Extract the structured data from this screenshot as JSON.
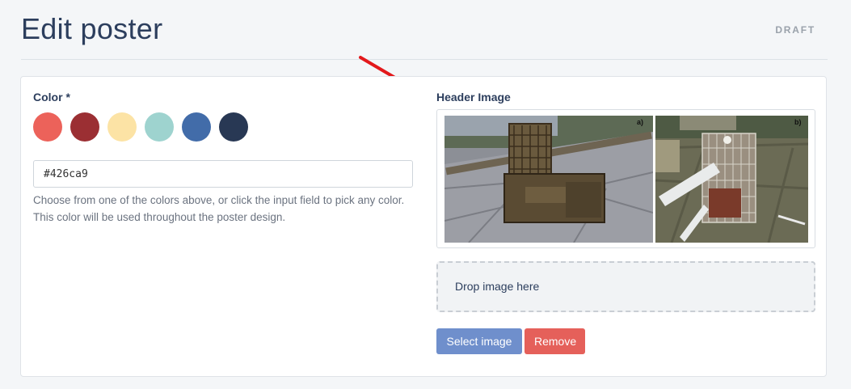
{
  "header": {
    "title": "Edit poster",
    "status": "DRAFT"
  },
  "color_section": {
    "label": "Color *",
    "swatches": [
      {
        "name": "coral",
        "color": "#ec625a"
      },
      {
        "name": "maroon",
        "color": "#9b2f33"
      },
      {
        "name": "cream",
        "color": "#fce3a5"
      },
      {
        "name": "teal",
        "color": "#9ed3cf"
      },
      {
        "name": "blue",
        "color": "#426ca9"
      },
      {
        "name": "navy",
        "color": "#283854"
      }
    ],
    "input_value": "#426ca9",
    "help_text": "Choose from one of the colors above, or click the input field to pick any color. This color will be used throughout the poster design."
  },
  "header_image": {
    "label": "Header Image",
    "photo_labels": [
      "a)",
      "b)"
    ],
    "dropzone_text": "Drop image here",
    "select_button": "Select image",
    "remove_button": "Remove"
  },
  "annotation": {
    "arrow_color": "#e3191c"
  }
}
